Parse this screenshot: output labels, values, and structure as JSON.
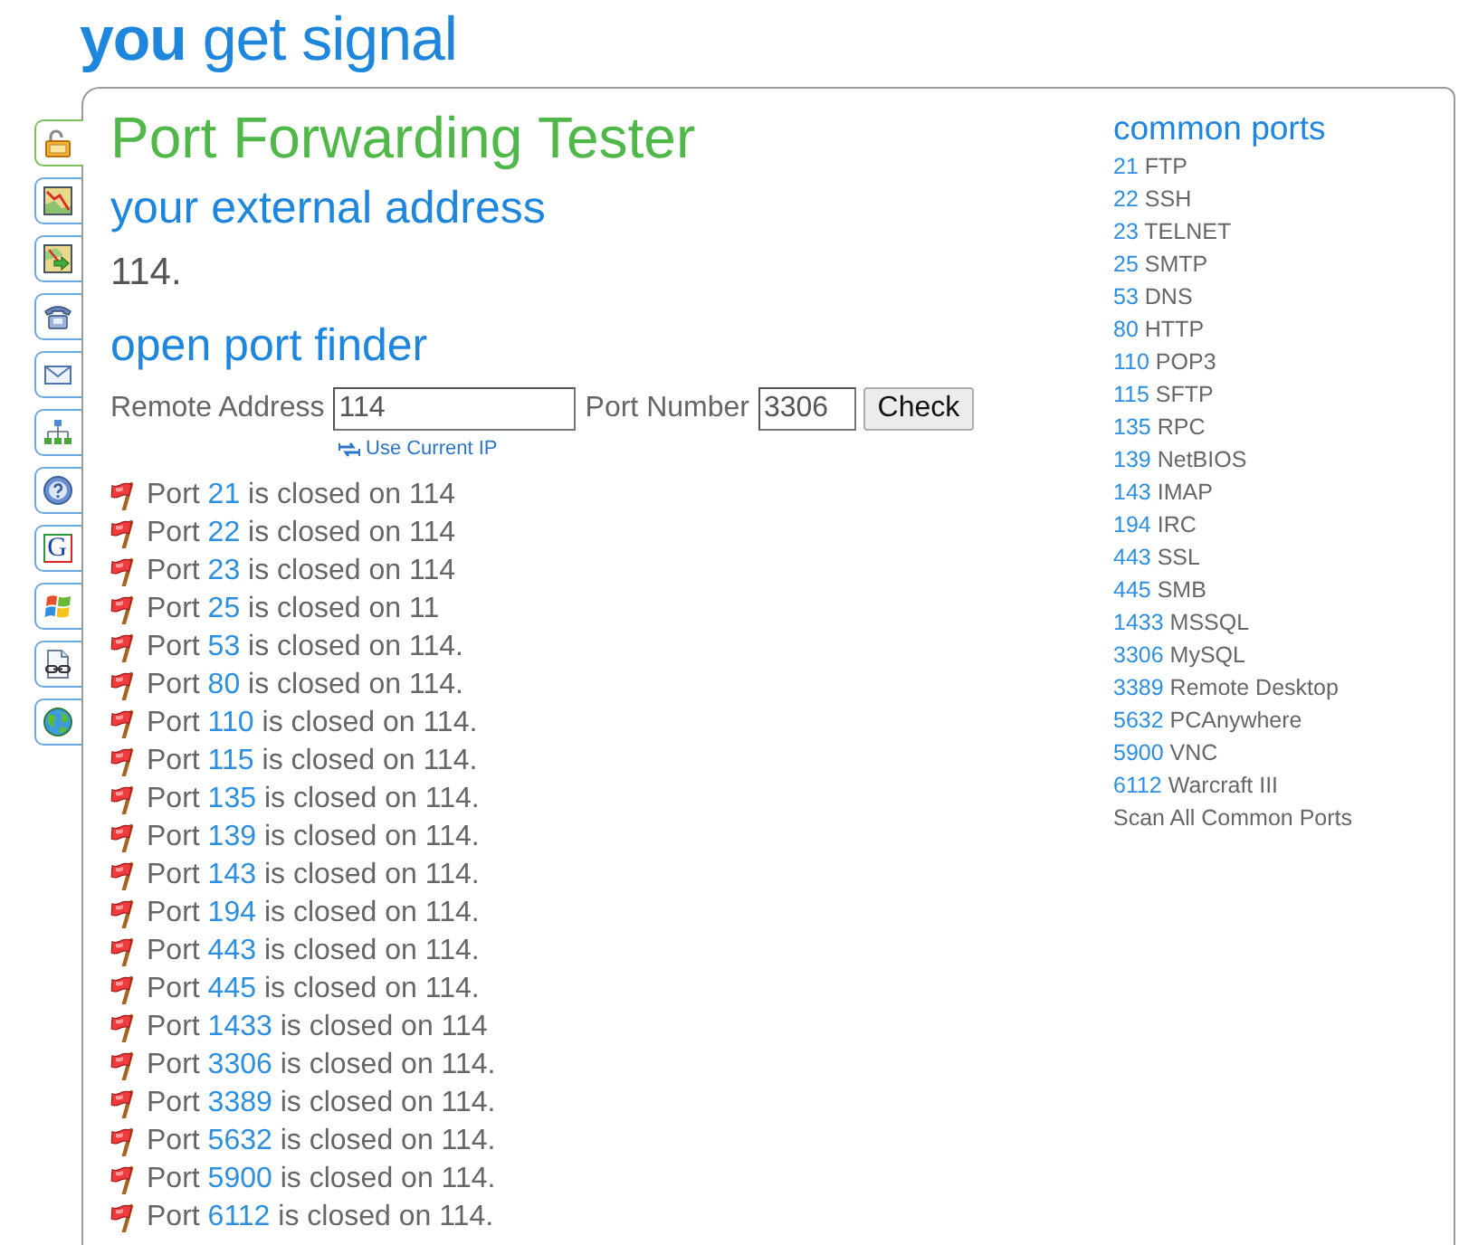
{
  "logo": {
    "text": "**you** get signal"
  },
  "side_tabs": [
    {
      "kind": "lock",
      "selected": true
    },
    {
      "kind": "chart",
      "selected": false
    },
    {
      "kind": "route",
      "selected": false
    },
    {
      "kind": "phone",
      "selected": false
    },
    {
      "kind": "mail",
      "selected": false
    },
    {
      "kind": "network",
      "selected": false
    },
    {
      "kind": "help",
      "selected": false
    },
    {
      "kind": "letter",
      "text": "G",
      "selected": false
    },
    {
      "kind": "flag",
      "selected": false
    },
    {
      "kind": "document",
      "selected": false
    },
    {
      "kind": "globe",
      "selected": false
    }
  ],
  "main": {
    "title": "Port Forwarding Tester",
    "external_address": {
      "heading": "your external address",
      "value": "114."
    },
    "finder": {
      "heading": "open port finder",
      "remote_address": {
        "label": "Remote Address",
        "value": "114"
      },
      "port_number": {
        "label": "Port Number",
        "value": "3306"
      },
      "check_button": "Check",
      "use_current_ip": "Use Current IP"
    },
    "results": [
      {
        "word": "Port",
        "port": "21",
        "status": "is closed on 114",
        "open": false
      },
      {
        "word": "Port",
        "port": "22",
        "status": "is closed on 114",
        "open": false
      },
      {
        "word": "Port",
        "port": "23",
        "status": "is closed on 114",
        "open": false
      },
      {
        "word": "Port",
        "port": "25",
        "status": "is closed on 11",
        "open": false
      },
      {
        "word": "Port",
        "port": "53",
        "status": "is closed on 114.",
        "open": false
      },
      {
        "word": "Port",
        "port": "80",
        "status": "is closed on 114.",
        "open": false
      },
      {
        "word": "Port",
        "port": "110",
        "status": "is closed on 114.",
        "open": false
      },
      {
        "word": "Port",
        "port": "115",
        "status": "is closed on 114.",
        "open": false
      },
      {
        "word": "Port",
        "port": "135",
        "status": "is closed on 114.",
        "open": false
      },
      {
        "word": "Port",
        "port": "139",
        "status": "is closed on 114.",
        "open": false
      },
      {
        "word": "Port",
        "port": "143",
        "status": "is closed on 114.",
        "open": false
      },
      {
        "word": "Port",
        "port": "194",
        "status": "is closed on 114.",
        "open": false
      },
      {
        "word": "Port",
        "port": "443",
        "status": "is closed on 114.",
        "open": false
      },
      {
        "word": "Port",
        "port": "445",
        "status": "is closed on 114.",
        "open": false
      },
      {
        "word": "Port",
        "port": "1433",
        "status": "is closed on 114",
        "open": false
      },
      {
        "word": "Port",
        "port": "3306",
        "status": "is closed on 114.",
        "open": false
      },
      {
        "word": "Port",
        "port": "3389",
        "status": "is closed on 114.",
        "open": false
      },
      {
        "word": "Port",
        "port": "5632",
        "status": "is closed on 114.",
        "open": false
      },
      {
        "word": "Port",
        "port": "5900",
        "status": "is closed on 114.",
        "open": false
      },
      {
        "word": "Port",
        "port": "6112",
        "status": "is closed on 114.",
        "open": false
      }
    ]
  },
  "common_ports": {
    "heading": "common ports",
    "items": [
      {
        "port": "21",
        "service": "FTP"
      },
      {
        "port": "22",
        "service": "SSH"
      },
      {
        "port": "23",
        "service": "TELNET"
      },
      {
        "port": "25",
        "service": "SMTP"
      },
      {
        "port": "53",
        "service": "DNS"
      },
      {
        "port": "80",
        "service": "HTTP"
      },
      {
        "port": "110",
        "service": "POP3"
      },
      {
        "port": "115",
        "service": "SFTP"
      },
      {
        "port": "135",
        "service": "RPC"
      },
      {
        "port": "139",
        "service": "NetBIOS"
      },
      {
        "port": "143",
        "service": "IMAP"
      },
      {
        "port": "194",
        "service": "IRC"
      },
      {
        "port": "443",
        "service": "SSL"
      },
      {
        "port": "445",
        "service": "SMB"
      },
      {
        "port": "1433",
        "service": "MSSQL"
      },
      {
        "port": "3306",
        "service": "MySQL"
      },
      {
        "port": "3389",
        "service": "Remote Desktop"
      },
      {
        "port": "5632",
        "service": "PCAnywhere"
      },
      {
        "port": "5900",
        "service": "VNC"
      },
      {
        "port": "6112",
        "service": "Warcraft III"
      }
    ],
    "scan_all": "Scan All Common Ports"
  }
}
